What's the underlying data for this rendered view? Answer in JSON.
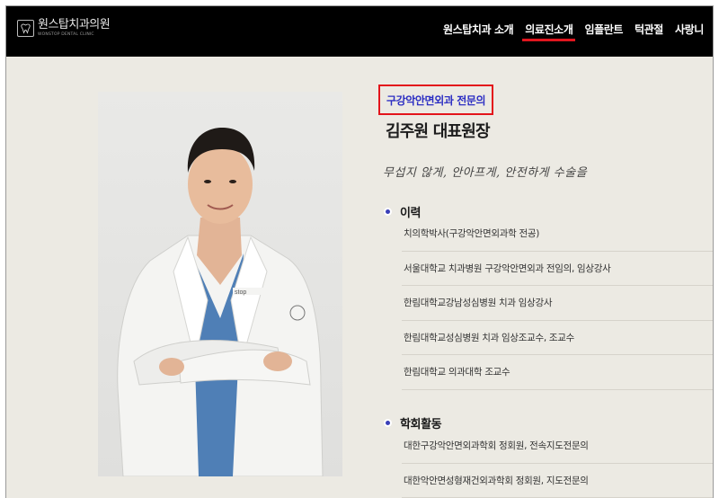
{
  "header": {
    "logo": {
      "name": "원스탑치과의원",
      "sub": "WONSTOP DENTAL CLINIC",
      "icon": "tooth-icon"
    },
    "nav": [
      {
        "label": "원스탑치과 소개",
        "active": false
      },
      {
        "label": "의료진소개",
        "active": true
      },
      {
        "label": "임플란트",
        "active": false
      },
      {
        "label": "턱관절",
        "active": false
      },
      {
        "label": "사랑니",
        "active": false
      }
    ]
  },
  "profile": {
    "subtitle": "구강악안면외과 전문의",
    "name": "김주원 대표원장",
    "slogan": "무섭지 않게, 안아프게, 안전하게 수술을"
  },
  "sections": {
    "career": {
      "title": "이력",
      "items": [
        "치의학박사(구강악안면외과학 전공)",
        "서울대학교 치과병원 구강악안면외과 전임의, 임상강사",
        "한림대학교강남성심병원 치과 임상강사",
        "한림대학교성심병원 치과 임상조교수, 조교수",
        "한림대학교 의과대학 조교수"
      ]
    },
    "society": {
      "title": "학회활동",
      "items": [
        "대한구강악안면외과학회 정회원, 전속지도전문의",
        "대한악안면성형재건외과학회 정회원, 지도전문의"
      ]
    }
  },
  "colors": {
    "accent_blue": "#2d2fc3",
    "highlight_red": "#e3141b",
    "background": "#eceae3"
  }
}
